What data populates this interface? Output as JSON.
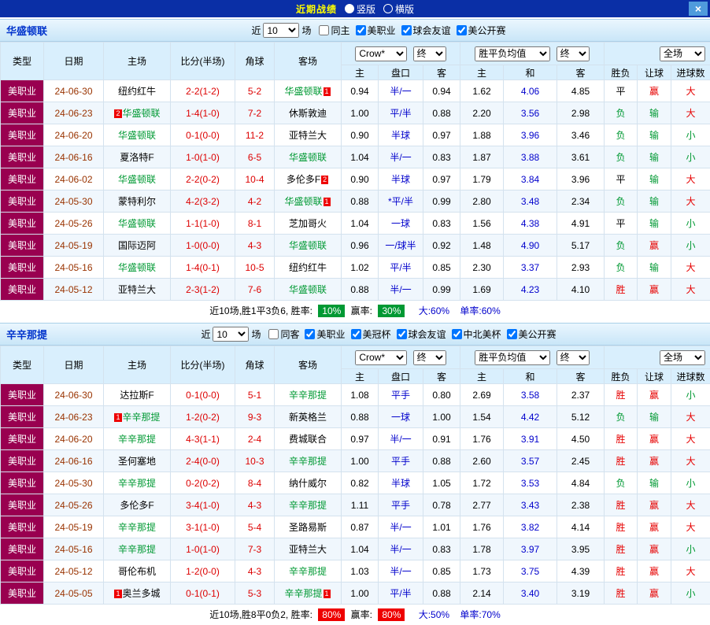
{
  "topbar": {
    "title": "近期战绩",
    "radio_vertical": "竖版",
    "radio_horizontal": "横版",
    "close": "×"
  },
  "colors": {
    "topbar_bg": "#0a2fa6",
    "title_color": "#ffff00",
    "close_btn_bg": "#4f9bdc",
    "team_title_color": "#0033cc",
    "table_header_bg": "#d9effd",
    "grid_border": "#d4e2ee",
    "league_bg": "#990050",
    "date_color": "#993300",
    "score_color": "#dd0000",
    "handicap_color": "#0000cc",
    "focus_team": "#009933",
    "badge_bg": "#ee0000",
    "win_color": "#e60000",
    "lose_color": "#009933",
    "rate_green": "#009933",
    "rate_red": "#ee0000",
    "blue_text": "#0000cc"
  },
  "text_color_map": {
    "胜": "c-red",
    "平": "c-black",
    "负": "c-green",
    "赢": "c-red",
    "输": "c-green",
    "大": "c-red",
    "小": "c-green"
  },
  "table_header": {
    "col_type": "类型",
    "col_date": "日期",
    "col_home": "主场",
    "col_score": "比分(半场)",
    "col_corner": "角球",
    "col_away": "客场",
    "odds_company": "Crow*",
    "odds_final": "终",
    "europe": "胜平负均值",
    "europe_final": "终",
    "fullmatch": "全场",
    "sub_home": "主",
    "sub_handicap": "盘口",
    "sub_away": "客",
    "sub_home2": "主",
    "sub_draw": "和",
    "sub_away2": "客",
    "sub_result": "胜负",
    "sub_handicap_result": "让球",
    "sub_goals": "进球数"
  },
  "sections": [
    {
      "team": "华盛顿联",
      "filters": {
        "recent": "近",
        "count": "10",
        "unit": "场",
        "checkboxes": [
          {
            "label": "同主",
            "checked": false
          },
          {
            "label": "美职业",
            "checked": true
          },
          {
            "label": "球会友谊",
            "checked": true
          },
          {
            "label": "美公开赛",
            "checked": true
          }
        ]
      },
      "rows": [
        {
          "league": "美职业",
          "date": "24-06-30",
          "home": {
            "name": "纽约红牛"
          },
          "score": "2-2(1-2)",
          "corner": "5-2",
          "away": {
            "name": "华盛顿联",
            "focus": true,
            "badge": "1",
            "badge_pos": "after"
          },
          "asia": [
            "0.94",
            "半/一",
            "0.94"
          ],
          "europe": [
            "1.62",
            "4.06",
            "4.85"
          ],
          "result": "平",
          "handicap_result": "赢",
          "goals": "大"
        },
        {
          "league": "美职业",
          "date": "24-06-23",
          "home": {
            "name": "华盛顿联",
            "focus": true,
            "badge": "2",
            "badge_pos": "before"
          },
          "score": "1-4(1-0)",
          "corner": "7-2",
          "away": {
            "name": "休斯敦迪"
          },
          "asia": [
            "1.00",
            "平/半",
            "0.88"
          ],
          "europe": [
            "2.20",
            "3.56",
            "2.98"
          ],
          "result": "负",
          "handicap_result": "输",
          "goals": "大"
        },
        {
          "league": "美职业",
          "date": "24-06-20",
          "home": {
            "name": "华盛顿联",
            "focus": true
          },
          "score": "0-1(0-0)",
          "corner": "11-2",
          "away": {
            "name": "亚特兰大"
          },
          "asia": [
            "0.90",
            "半球",
            "0.97"
          ],
          "europe": [
            "1.88",
            "3.96",
            "3.46"
          ],
          "result": "负",
          "handicap_result": "输",
          "goals": "小"
        },
        {
          "league": "美职业",
          "date": "24-06-16",
          "home": {
            "name": "夏洛特F"
          },
          "score": "1-0(1-0)",
          "corner": "6-5",
          "away": {
            "name": "华盛顿联",
            "focus": true
          },
          "asia": [
            "1.04",
            "半/一",
            "0.83"
          ],
          "europe": [
            "1.87",
            "3.88",
            "3.61"
          ],
          "result": "负",
          "handicap_result": "输",
          "goals": "小"
        },
        {
          "league": "美职业",
          "date": "24-06-02",
          "home": {
            "name": "华盛顿联",
            "focus": true
          },
          "score": "2-2(0-2)",
          "corner": "10-4",
          "away": {
            "name": "多伦多F",
            "badge": "2",
            "badge_pos": "after"
          },
          "asia": [
            "0.90",
            "半球",
            "0.97"
          ],
          "europe": [
            "1.79",
            "3.84",
            "3.96"
          ],
          "result": "平",
          "handicap_result": "输",
          "goals": "大"
        },
        {
          "league": "美职业",
          "date": "24-05-30",
          "home": {
            "name": "蒙特利尔"
          },
          "score": "4-2(3-2)",
          "corner": "4-2",
          "away": {
            "name": "华盛顿联",
            "focus": true,
            "badge": "1",
            "badge_pos": "after"
          },
          "asia": [
            "0.88",
            "*平/半",
            "0.99"
          ],
          "europe": [
            "2.80",
            "3.48",
            "2.34"
          ],
          "result": "负",
          "handicap_result": "输",
          "goals": "大"
        },
        {
          "league": "美职业",
          "date": "24-05-26",
          "home": {
            "name": "华盛顿联",
            "focus": true
          },
          "score": "1-1(1-0)",
          "corner": "8-1",
          "away": {
            "name": "芝加哥火"
          },
          "asia": [
            "1.04",
            "一球",
            "0.83"
          ],
          "europe": [
            "1.56",
            "4.38",
            "4.91"
          ],
          "result": "平",
          "handicap_result": "输",
          "goals": "小"
        },
        {
          "league": "美职业",
          "date": "24-05-19",
          "home": {
            "name": "国际迈阿"
          },
          "score": "1-0(0-0)",
          "corner": "4-3",
          "away": {
            "name": "华盛顿联",
            "focus": true
          },
          "asia": [
            "0.96",
            "一/球半",
            "0.92"
          ],
          "europe": [
            "1.48",
            "4.90",
            "5.17"
          ],
          "result": "负",
          "handicap_result": "赢",
          "goals": "小"
        },
        {
          "league": "美职业",
          "date": "24-05-16",
          "home": {
            "name": "华盛顿联",
            "focus": true
          },
          "score": "1-4(0-1)",
          "corner": "10-5",
          "away": {
            "name": "纽约红牛"
          },
          "asia": [
            "1.02",
            "平/半",
            "0.85"
          ],
          "europe": [
            "2.30",
            "3.37",
            "2.93"
          ],
          "result": "负",
          "handicap_result": "输",
          "goals": "大"
        },
        {
          "league": "美职业",
          "date": "24-05-12",
          "home": {
            "name": "亚特兰大"
          },
          "score": "2-3(1-2)",
          "corner": "7-6",
          "away": {
            "name": "华盛顿联",
            "focus": true
          },
          "asia": [
            "0.88",
            "半/一",
            "0.99"
          ],
          "europe": [
            "1.69",
            "4.23",
            "4.10"
          ],
          "result": "胜",
          "handicap_result": "赢",
          "goals": "大"
        }
      ],
      "summary": {
        "prefix": "近10场,胜1平3负6, 胜率:",
        "win_rate": "10%",
        "handicap_label": "赢率:",
        "handicap_rate": "30%",
        "big": "大:60%",
        "single": "单率:60%",
        "box_class": "green"
      }
    },
    {
      "team": "辛辛那提",
      "filters": {
        "recent": "近",
        "count": "10",
        "unit": "场",
        "checkboxes": [
          {
            "label": "同客",
            "checked": false
          },
          {
            "label": "美职业",
            "checked": true
          },
          {
            "label": "美冠杯",
            "checked": true
          },
          {
            "label": "球会友谊",
            "checked": true
          },
          {
            "label": "中北美杯",
            "checked": true
          },
          {
            "label": "美公开赛",
            "checked": true
          }
        ]
      },
      "rows": [
        {
          "league": "美职业",
          "date": "24-06-30",
          "home": {
            "name": "达拉斯F"
          },
          "score": "0-1(0-0)",
          "corner": "5-1",
          "away": {
            "name": "辛辛那提",
            "focus": true
          },
          "asia": [
            "1.08",
            "平手",
            "0.80"
          ],
          "europe": [
            "2.69",
            "3.58",
            "2.37"
          ],
          "result": "胜",
          "handicap_result": "赢",
          "goals": "小"
        },
        {
          "league": "美职业",
          "date": "24-06-23",
          "home": {
            "name": "辛辛那提",
            "focus": true,
            "badge": "1",
            "badge_pos": "before"
          },
          "score": "1-2(0-2)",
          "corner": "9-3",
          "away": {
            "name": "新英格兰"
          },
          "asia": [
            "0.88",
            "一球",
            "1.00"
          ],
          "europe": [
            "1.54",
            "4.42",
            "5.12"
          ],
          "result": "负",
          "handicap_result": "输",
          "goals": "大"
        },
        {
          "league": "美职业",
          "date": "24-06-20",
          "home": {
            "name": "辛辛那提",
            "focus": true
          },
          "score": "4-3(1-1)",
          "corner": "2-4",
          "away": {
            "name": "费城联合"
          },
          "asia": [
            "0.97",
            "半/一",
            "0.91"
          ],
          "europe": [
            "1.76",
            "3.91",
            "4.50"
          ],
          "result": "胜",
          "handicap_result": "赢",
          "goals": "大"
        },
        {
          "league": "美职业",
          "date": "24-06-16",
          "home": {
            "name": "圣何塞地"
          },
          "score": "2-4(0-0)",
          "corner": "10-3",
          "away": {
            "name": "辛辛那提",
            "focus": true
          },
          "asia": [
            "1.00",
            "平手",
            "0.88"
          ],
          "europe": [
            "2.60",
            "3.57",
            "2.45"
          ],
          "result": "胜",
          "handicap_result": "赢",
          "goals": "大"
        },
        {
          "league": "美职业",
          "date": "24-05-30",
          "home": {
            "name": "辛辛那提",
            "focus": true
          },
          "score": "0-2(0-2)",
          "corner": "8-4",
          "away": {
            "name": "纳什威尔"
          },
          "asia": [
            "0.82",
            "半球",
            "1.05"
          ],
          "europe": [
            "1.72",
            "3.53",
            "4.84"
          ],
          "result": "负",
          "handicap_result": "输",
          "goals": "小"
        },
        {
          "league": "美职业",
          "date": "24-05-26",
          "home": {
            "name": "多伦多F"
          },
          "score": "3-4(1-0)",
          "corner": "4-3",
          "away": {
            "name": "辛辛那提",
            "focus": true
          },
          "asia": [
            "1.11",
            "平手",
            "0.78"
          ],
          "europe": [
            "2.77",
            "3.43",
            "2.38"
          ],
          "result": "胜",
          "handicap_result": "赢",
          "goals": "大"
        },
        {
          "league": "美职业",
          "date": "24-05-19",
          "home": {
            "name": "辛辛那提",
            "focus": true
          },
          "score": "3-1(1-0)",
          "corner": "5-4",
          "away": {
            "name": "圣路易斯"
          },
          "asia": [
            "0.87",
            "半/一",
            "1.01"
          ],
          "europe": [
            "1.76",
            "3.82",
            "4.14"
          ],
          "result": "胜",
          "handicap_result": "赢",
          "goals": "大"
        },
        {
          "league": "美职业",
          "date": "24-05-16",
          "home": {
            "name": "辛辛那提",
            "focus": true
          },
          "score": "1-0(1-0)",
          "corner": "7-3",
          "away": {
            "name": "亚特兰大"
          },
          "asia": [
            "1.04",
            "半/一",
            "0.83"
          ],
          "europe": [
            "1.78",
            "3.97",
            "3.95"
          ],
          "result": "胜",
          "handicap_result": "赢",
          "goals": "小"
        },
        {
          "league": "美职业",
          "date": "24-05-12",
          "home": {
            "name": "哥伦布机"
          },
          "score": "1-2(0-0)",
          "corner": "4-3",
          "away": {
            "name": "辛辛那提",
            "focus": true
          },
          "asia": [
            "1.03",
            "半/一",
            "0.85"
          ],
          "europe": [
            "1.73",
            "3.75",
            "4.39"
          ],
          "result": "胜",
          "handicap_result": "赢",
          "goals": "大"
        },
        {
          "league": "美职业",
          "date": "24-05-05",
          "home": {
            "name": "奥兰多城",
            "badge": "1",
            "badge_pos": "before"
          },
          "score": "0-1(0-1)",
          "corner": "5-3",
          "away": {
            "name": "辛辛那提",
            "focus": true,
            "badge": "1",
            "badge_pos": "after"
          },
          "asia": [
            "1.00",
            "平/半",
            "0.88"
          ],
          "europe": [
            "2.14",
            "3.40",
            "3.19"
          ],
          "result": "胜",
          "handicap_result": "赢",
          "goals": "小"
        }
      ],
      "summary": {
        "prefix": "近10场,胜8平0负2, 胜率:",
        "win_rate": "80%",
        "handicap_label": "赢率:",
        "handicap_rate": "80%",
        "big": "大:50%",
        "single": "单率:70%",
        "box_class": "red"
      }
    }
  ]
}
